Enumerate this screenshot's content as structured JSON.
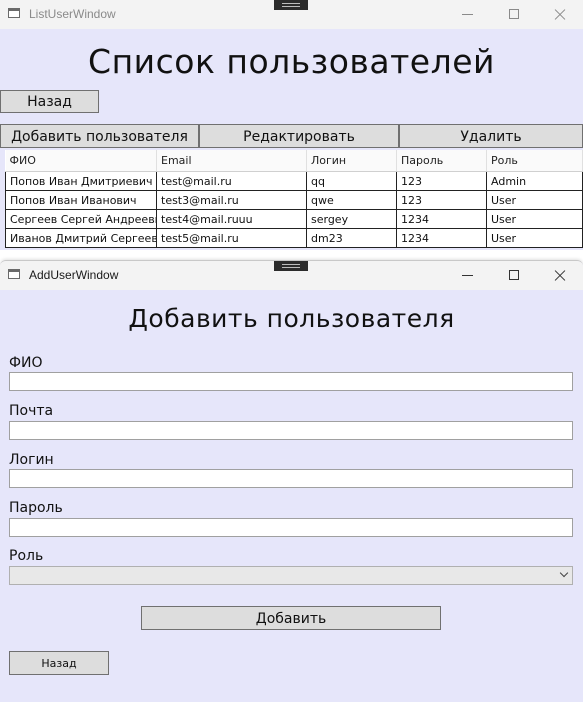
{
  "list_window": {
    "title": "ListUserWindow",
    "heading": "Список пользователей",
    "back_label": "Назад",
    "toolbar": {
      "add_label": "Добавить пользователя",
      "edit_label": "Редактировать",
      "delete_label": "Удалить"
    },
    "table": {
      "headers": [
        "ФИО",
        "Email",
        "Логин",
        "Пароль",
        "Роль"
      ],
      "rows": [
        [
          "Попов Иван Дмитриевич",
          "test@mail.ru",
          "qq",
          "123",
          "Admin"
        ],
        [
          "Попов Иван Иванович",
          "test3@mail.ru",
          "qwe",
          "123",
          "User"
        ],
        [
          "Сергеев Сергей Андреевич",
          "test4@mail.ruuu",
          "sergey",
          "1234",
          "User"
        ],
        [
          "Иванов Дмитрий Сергеевич",
          "test5@mail.ru",
          "dm23",
          "1234",
          "User"
        ]
      ]
    }
  },
  "add_window": {
    "title": "AddUserWindow",
    "heading": "Добавить пользователя",
    "fields": {
      "fio_label": "ФИО",
      "email_label": "Почта",
      "login_label": "Логин",
      "password_label": "Пароль",
      "role_label": "Роль"
    },
    "values": {
      "fio": "",
      "email": "",
      "login": "",
      "password": "",
      "role": ""
    },
    "submit_label": "Добавить",
    "back_label": "Назад"
  },
  "colors": {
    "window_bg": "#e6e6fa",
    "titlebar_bg": "#f3f3f3",
    "button_bg": "#dddddd",
    "button_border": "#707070"
  },
  "icons": [
    "app-icon",
    "grip-icon",
    "minimize-icon",
    "maximize-icon",
    "close-icon",
    "chevron-down-icon"
  ]
}
